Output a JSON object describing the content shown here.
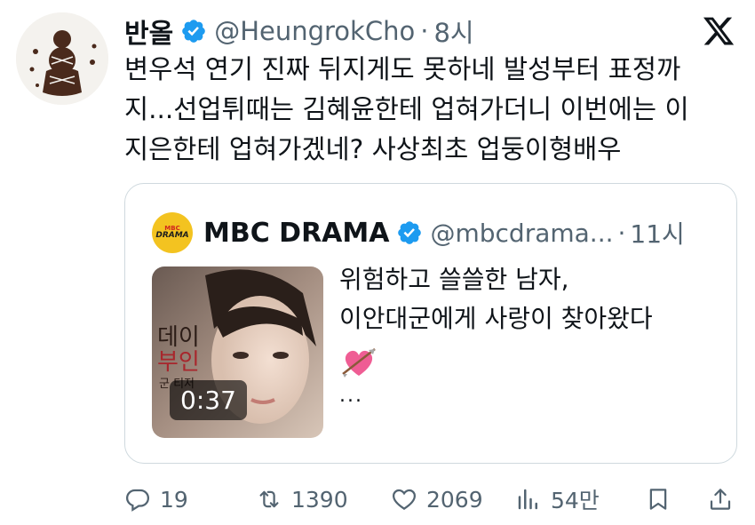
{
  "tweet": {
    "display_name": "반올",
    "handle": "@HeungrokCho",
    "dot": "·",
    "time": "8시",
    "text": "변우석 연기 진짜 뒤지게도 못하네 발성부터 표정까\n지...선업튀때는 김혜윤한테 업혀가더니 이번에는 이\n지은한테 업혀가겠네? 사상최초 업둥이형배우"
  },
  "quote": {
    "avatar_top": "MBC",
    "avatar_bottom": "DRAMA",
    "display_name": "MBC DRAMA",
    "handle": "@mbcdrama...",
    "dot": "·",
    "time": "11시",
    "text": "위험하고 쓸쓸한 남자,\n이안대군에게 사랑이 찾아왔다",
    "ellipsis": "...",
    "video_duration": "0:37",
    "thumbnail_text_1": "데이",
    "thumbnail_text_2": "부인",
    "thumbnail_text_3": "군 티저"
  },
  "actions": {
    "replies": "19",
    "reposts": "1390",
    "likes": "2069",
    "views": "54만"
  },
  "colors": {
    "verified": "#1d9bf0",
    "text": "#0f1419",
    "muted": "#536471",
    "border": "#cfd9de"
  },
  "icons": [
    "verified-badge-icon",
    "x-logo-icon",
    "reply-icon",
    "repost-icon",
    "like-icon",
    "views-icon",
    "bookmark-icon",
    "share-icon",
    "heart-arrow-emoji-icon"
  ]
}
